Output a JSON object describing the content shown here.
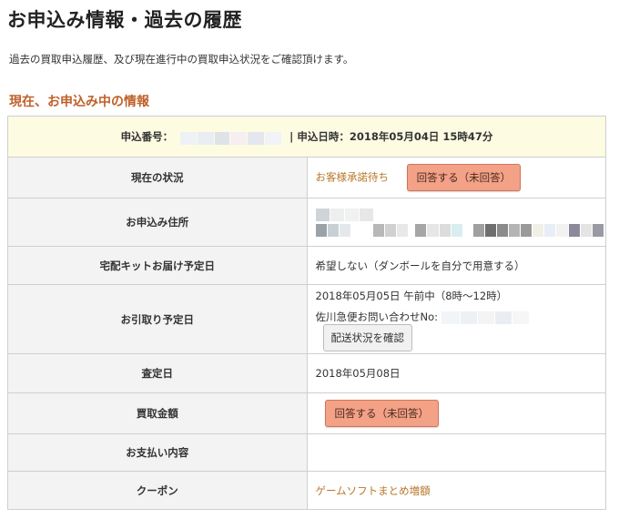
{
  "header": {
    "title": "お申込み情報・過去の履歴",
    "description": "過去の買取申込履歴、及び現在進行中の買取申込状況をご確認頂けます。"
  },
  "section": {
    "title": "現在、お申込み中の情報"
  },
  "application": {
    "number_label": "申込番号：",
    "date_label": "| 申込日時：2018年05月04日 15時47分"
  },
  "rows": {
    "status": {
      "label": "現在の状況",
      "value": "お客様承諾待ち",
      "button": "回答する（未回答）"
    },
    "address": {
      "label": "お申込み住所"
    },
    "kit": {
      "label": "宅配キットお届け予定日",
      "value": "希望しない（ダンボールを自分で用意する）"
    },
    "pickup": {
      "label": "お引取り予定日",
      "value": "2018年05月05日 午前中（8時～12時）",
      "tracking_label": "佐川急便お問い合わせNo:",
      "tracking_button": "配送状況を確認"
    },
    "assessment": {
      "label": "査定日",
      "value": "2018年05月08日"
    },
    "price": {
      "label": "買取金額",
      "button": "回答する（未回答）"
    },
    "payment": {
      "label": "お支払い内容"
    },
    "coupon": {
      "label": "クーポン",
      "value": "ゲームソフトまとめ増額"
    }
  },
  "colors": {
    "heading_accent": "#c0602a",
    "header_row_bg": "#fdfbe2",
    "label_bg": "#f3f3f3",
    "answer_button_bg": "#f3a187",
    "link_orange": "#b8772a"
  }
}
